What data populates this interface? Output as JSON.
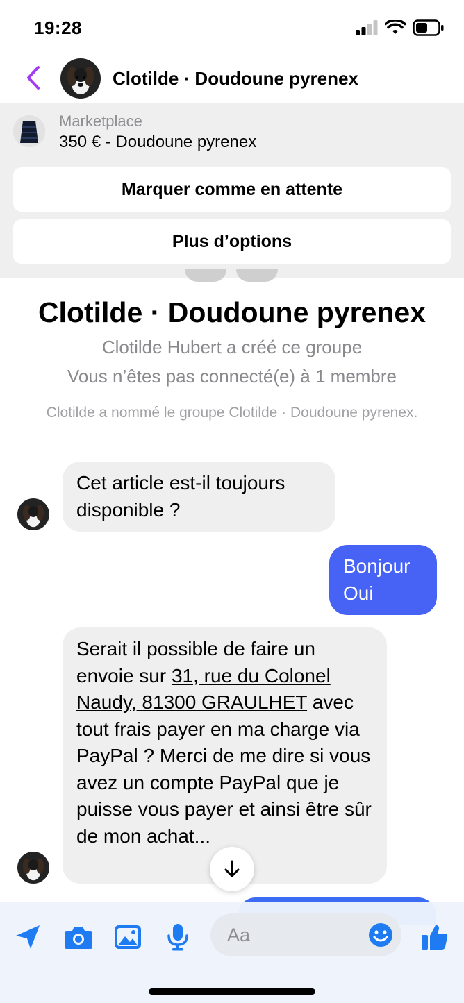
{
  "status_bar": {
    "time": "19:28"
  },
  "header": {
    "title": "Clotilde · Doudoune pyrenex"
  },
  "marketplace": {
    "label": "Marketplace",
    "item": "350 € - Doudoune pyrenex",
    "mark_pending_button": "Marquer comme en attente",
    "more_options_button": "Plus d’options"
  },
  "group": {
    "title": "Clotilde · Doudoune pyrenex",
    "created_by": "Clotilde Hubert a créé ce groupe",
    "connection": "Vous n’êtes pas connecté(e) à 1 membre",
    "system_message": "Clotilde a nommé le groupe Clotilde · Doudoune pyrenex."
  },
  "messages": {
    "m1": "Cet article est-il toujours disponible ?",
    "m2_line1": "Bonjour",
    "m2_line2": "Oui",
    "m3_before_link": "Serait il possible de faire un envoie sur ",
    "m3_link": "31, rue du Colonel Naudy, 81300 GRAULHET",
    "m3_after_link": " avec tout frais payer en ma charge via PayPal ?  Merci de me dire si vous avez un compte PayPal que je puisse vous payer et ainsi être sûr de mon achat..."
  },
  "composer": {
    "placeholder": "Aa"
  },
  "colors": {
    "accent": "#4663f5",
    "icon_blue": "#1f7bf2",
    "back_purple": "#a23cf0",
    "bubble_gray": "#efefef"
  },
  "icons": {
    "back": "chevron-left-icon",
    "send": "send-arrow-icon",
    "camera": "camera-icon",
    "gallery": "image-icon",
    "mic": "microphone-icon",
    "emoji": "smiley-icon",
    "like": "thumbs-up-icon",
    "scroll": "arrow-down-icon"
  }
}
